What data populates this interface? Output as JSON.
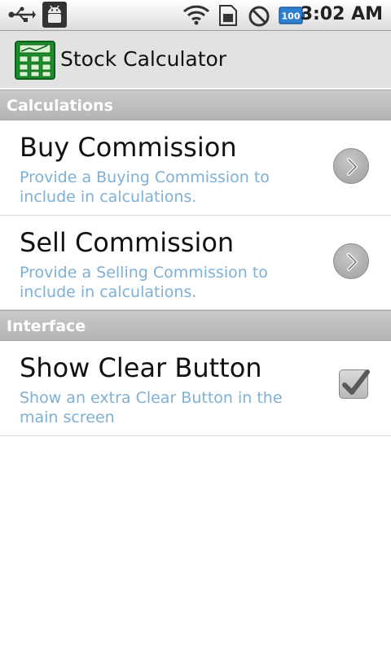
{
  "status_bar": {
    "time": "3:02 AM",
    "battery_level": "100",
    "icons": [
      "usb-icon",
      "android-debug-icon",
      "wifi-icon",
      "sim-card-icon",
      "no-signal-icon",
      "battery-icon"
    ]
  },
  "app": {
    "title": "Stock Calculator",
    "icon": "calculator-icon"
  },
  "sections": {
    "calculations": {
      "header": "Calculations",
      "items": [
        {
          "title": "Buy Commission",
          "summary": "Provide a Buying Commission to include in calculations.",
          "widget": "chevron-right-icon"
        },
        {
          "title": "Sell Commission",
          "summary": "Provide a Selling Commission to include in calculations.",
          "widget": "chevron-right-icon"
        }
      ]
    },
    "interface": {
      "header": "Interface",
      "items": [
        {
          "title": "Show Clear Button",
          "summary": "Show an extra Clear Button in the main screen",
          "widget": "checkbox",
          "checked": true
        }
      ]
    }
  }
}
